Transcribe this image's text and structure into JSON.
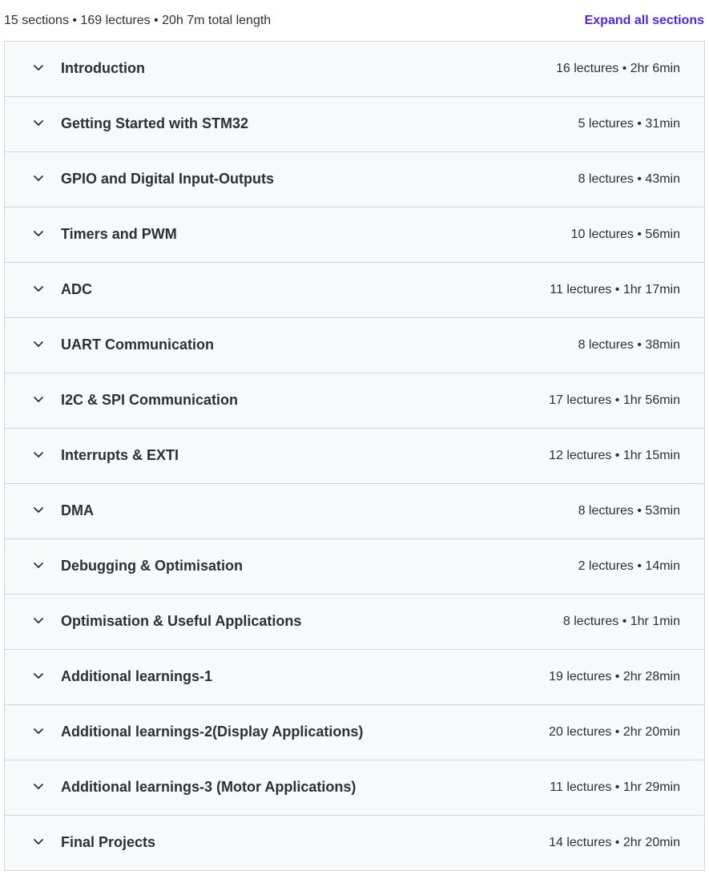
{
  "summary": {
    "text": "15 sections • 169 lectures • 20h 7m total length",
    "expand_label": "Expand all sections"
  },
  "colors": {
    "accent": "#5624d0",
    "text": "#2d2f31",
    "row_bg": "#f7f9fa",
    "border": "#d1d7dc"
  },
  "sections": [
    {
      "title": "Introduction",
      "meta": "16 lectures • 2hr 6min"
    },
    {
      "title": "Getting Started with STM32",
      "meta": "5 lectures • 31min"
    },
    {
      "title": "GPIO and Digital Input-Outputs",
      "meta": "8 lectures • 43min"
    },
    {
      "title": "Timers and PWM",
      "meta": "10 lectures • 56min"
    },
    {
      "title": "ADC",
      "meta": "11 lectures • 1hr 17min"
    },
    {
      "title": "UART Communication",
      "meta": "8 lectures • 38min"
    },
    {
      "title": "I2C & SPI Communication",
      "meta": "17 lectures • 1hr 56min"
    },
    {
      "title": "Interrupts & EXTI",
      "meta": "12 lectures • 1hr 15min"
    },
    {
      "title": "DMA",
      "meta": "8 lectures • 53min"
    },
    {
      "title": "Debugging & Optimisation",
      "meta": "2 lectures • 14min"
    },
    {
      "title": "Optimisation & Useful Applications",
      "meta": "8 lectures • 1hr 1min"
    },
    {
      "title": "Additional learnings-1",
      "meta": "19 lectures • 2hr 28min"
    },
    {
      "title": "Additional learnings-2(Display Applications)",
      "meta": "20 lectures • 2hr 20min"
    },
    {
      "title": "Additional learnings-3 (Motor Applications)",
      "meta": "11 lectures • 1hr 29min"
    },
    {
      "title": "Final Projects",
      "meta": "14 lectures • 2hr 20min"
    }
  ],
  "icons": {
    "section_toggle": "chevron-down-icon"
  }
}
